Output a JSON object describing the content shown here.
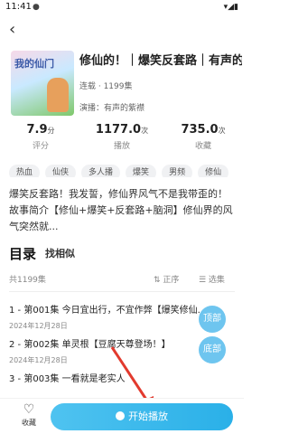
{
  "status": {
    "time": "11:41",
    "dot": "●",
    "icons": "▾◢▮"
  },
  "nav": {
    "back": "‹"
  },
  "book": {
    "title": "修仙的！｜爆笑反套路｜有声的",
    "cover_text": "我的仙门",
    "episodes": "连载 · 1199集",
    "narrator": "演播：有声的紫襟"
  },
  "stats": [
    {
      "value": "7.9",
      "unit": "分",
      "label": "评分"
    },
    {
      "value": "1177.0",
      "unit": "次",
      "label": "播放"
    },
    {
      "value": "735.0",
      "unit": "次",
      "label": "收藏"
    }
  ],
  "tags": [
    "热血",
    "仙侠",
    "多人播",
    "爆笑",
    "男频",
    "修仙"
  ],
  "description": "爆笑反套路！我发誓，修仙界风气不是我带歪的！故事简介【修仙+爆笑+反套路+脑洞】修仙界的风气突然就...",
  "catalog": {
    "title": "目录",
    "find_similar": "找相似",
    "total": "共1199集",
    "sort_label": "⇅ 正序",
    "select_label": "☰ 选集"
  },
  "episodes_list": [
    {
      "title": "1 - 第001集 今日宜出行，不宜作弊【爆笑修仙...",
      "date": "2024年12月28日"
    },
    {
      "title": "2 - 第002集 单灵根【豆腐天尊登场！】",
      "date": "2024年12月28日"
    },
    {
      "title": "3 - 第003集 一看就是老实人",
      "date": ""
    }
  ],
  "float": {
    "top": "顶部",
    "bottom": "底部"
  },
  "bottom": {
    "fav_icon": "♡",
    "fav_label": "收藏",
    "play_label": "开始播放"
  }
}
